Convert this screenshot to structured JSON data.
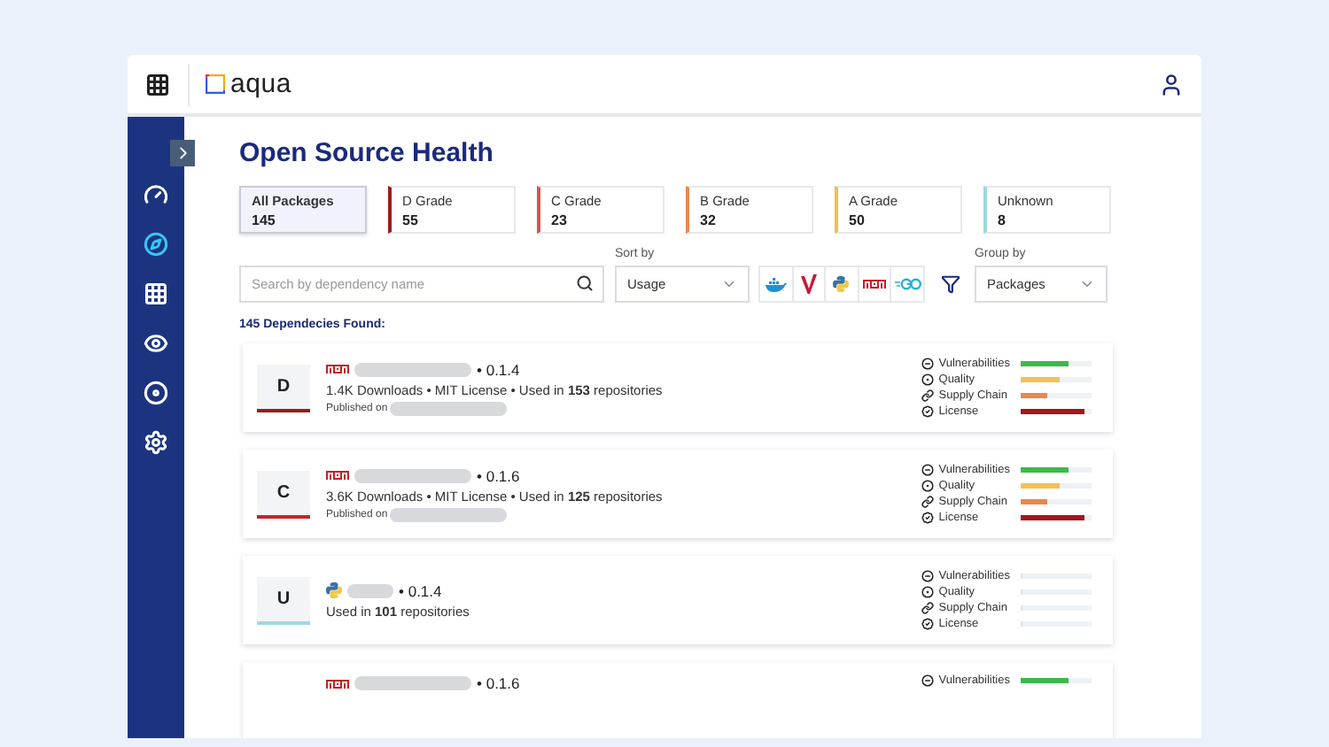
{
  "header": {
    "logo_text": "aqua"
  },
  "sidebar": {
    "items": [
      {
        "kind": "gauge",
        "selected": false
      },
      {
        "kind": "compass",
        "selected": true
      },
      {
        "kind": "grid",
        "selected": false
      },
      {
        "kind": "eye",
        "selected": false
      },
      {
        "kind": "disc",
        "selected": false
      },
      {
        "kind": "gear",
        "selected": false
      }
    ]
  },
  "title": "Open Source Health",
  "filters": [
    {
      "label": "All Packages",
      "count": "145",
      "selected": true
    },
    {
      "label": "D Grade",
      "count": "55",
      "color": "#9b1c1c",
      "selected": false
    },
    {
      "label": "C Grade",
      "count": "23",
      "color": "#d9534f",
      "selected": false
    },
    {
      "label": "B Grade",
      "count": "32",
      "color": "#e8884d",
      "selected": false
    },
    {
      "label": "A Grade",
      "count": "50",
      "color": "#f0c04a",
      "selected": false
    },
    {
      "label": "Unknown",
      "count": "8",
      "color": "#9fd8e0",
      "selected": false
    }
  ],
  "search": {
    "placeholder": "Search by dependency name"
  },
  "sort": {
    "label": "Sort by",
    "value": "Usage"
  },
  "ecosystems": [
    {
      "kind": "docker",
      "selected": false
    },
    {
      "kind": "maven",
      "selected": false
    },
    {
      "kind": "python",
      "selected": false
    },
    {
      "kind": "npm",
      "selected": false
    },
    {
      "kind": "go",
      "selected": false
    }
  ],
  "group": {
    "label": "Group by",
    "value": "Packages"
  },
  "found": "145 Dependecies Found:",
  "packages": [
    {
      "grade": "D",
      "color": "#9b1c1c",
      "kind": "npm",
      "version": "• 0.1.4",
      "details": "1.4K Downloads • MIT License • Used in **153** repositories",
      "published": "Published on",
      "metrics": [
        {
          "kind": "vulnerabilities",
          "label": "Vulnerabilities",
          "level": 0.68,
          "color": "#3cb94a"
        },
        {
          "kind": "quality",
          "label": "Quality",
          "level": 0.55,
          "color": "#f2c05a"
        },
        {
          "kind": "supply_chain",
          "label": "Supply Chain",
          "level": 0.38,
          "color": "#e8884d"
        },
        {
          "kind": "license",
          "label": "License",
          "level": 0.9,
          "color": "#a3161a"
        }
      ]
    },
    {
      "grade": "C",
      "color": "#c8232c",
      "kind": "npm",
      "version": "• 0.1.6",
      "details": "3.6K Downloads • MIT License • Used in **125** repositories",
      "published": "Published on",
      "metrics": [
        {
          "kind": "vulnerabilities",
          "label": "Vulnerabilities",
          "level": 0.68,
          "color": "#3cb94a"
        },
        {
          "kind": "quality",
          "label": "Quality",
          "level": 0.55,
          "color": "#f2c05a"
        },
        {
          "kind": "supply_chain",
          "label": "Supply Chain",
          "level": 0.38,
          "color": "#e8884d"
        },
        {
          "kind": "license",
          "label": "License",
          "level": 0.9,
          "color": "#a3161a"
        }
      ]
    },
    {
      "grade": "U",
      "color": "#9fd8e0",
      "kind": "python",
      "version": "• 0.1.4",
      "details": "Used in **101** repositories",
      "metrics": [
        {
          "kind": "vulnerabilities",
          "label": "Vulnerabilities",
          "level": 0
        },
        {
          "kind": "quality",
          "label": "Quality",
          "level": 0
        },
        {
          "kind": "supply_chain",
          "label": "Supply Chain",
          "level": 0
        },
        {
          "kind": "license",
          "label": "License",
          "level": 0
        }
      ]
    },
    {
      "kind": "npm",
      "version": "• 0.1.6",
      "metrics": [
        {
          "kind": "vulnerabilities",
          "label": "Vulnerabilities",
          "level": 0.68,
          "color": "#3cb94a"
        }
      ]
    }
  ]
}
